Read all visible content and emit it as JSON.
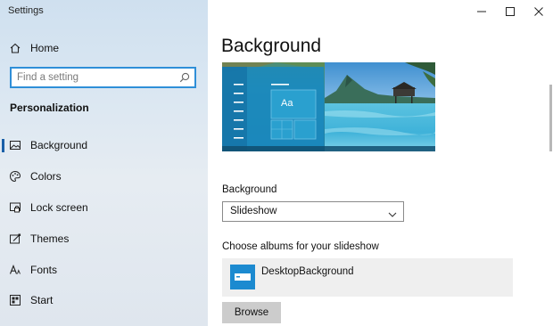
{
  "window": {
    "title": "Settings"
  },
  "sidebar": {
    "home_label": "Home",
    "search": {
      "placeholder": "Find a setting"
    },
    "section_title": "Personalization",
    "items": [
      {
        "label": "Background",
        "icon": "picture-icon",
        "selected": true
      },
      {
        "label": "Colors",
        "icon": "palette-icon",
        "selected": false
      },
      {
        "label": "Lock screen",
        "icon": "lock-screen-icon",
        "selected": false
      },
      {
        "label": "Themes",
        "icon": "themes-icon",
        "selected": false
      },
      {
        "label": "Fonts",
        "icon": "fonts-icon",
        "selected": false
      },
      {
        "label": "Start",
        "icon": "start-icon",
        "selected": false
      }
    ]
  },
  "main": {
    "title": "Background",
    "preview": {
      "sample_text": "Aa"
    },
    "background_field": {
      "label": "Background",
      "value": "Slideshow"
    },
    "albums": {
      "label": "Choose albums for your slideshow",
      "items": [
        {
          "name": "DesktopBackground"
        }
      ],
      "browse_label": "Browse"
    }
  },
  "colors": {
    "accent": "#1c8ad0",
    "selection_bar": "#1a5fa8",
    "search_border": "#2f8fd8"
  }
}
